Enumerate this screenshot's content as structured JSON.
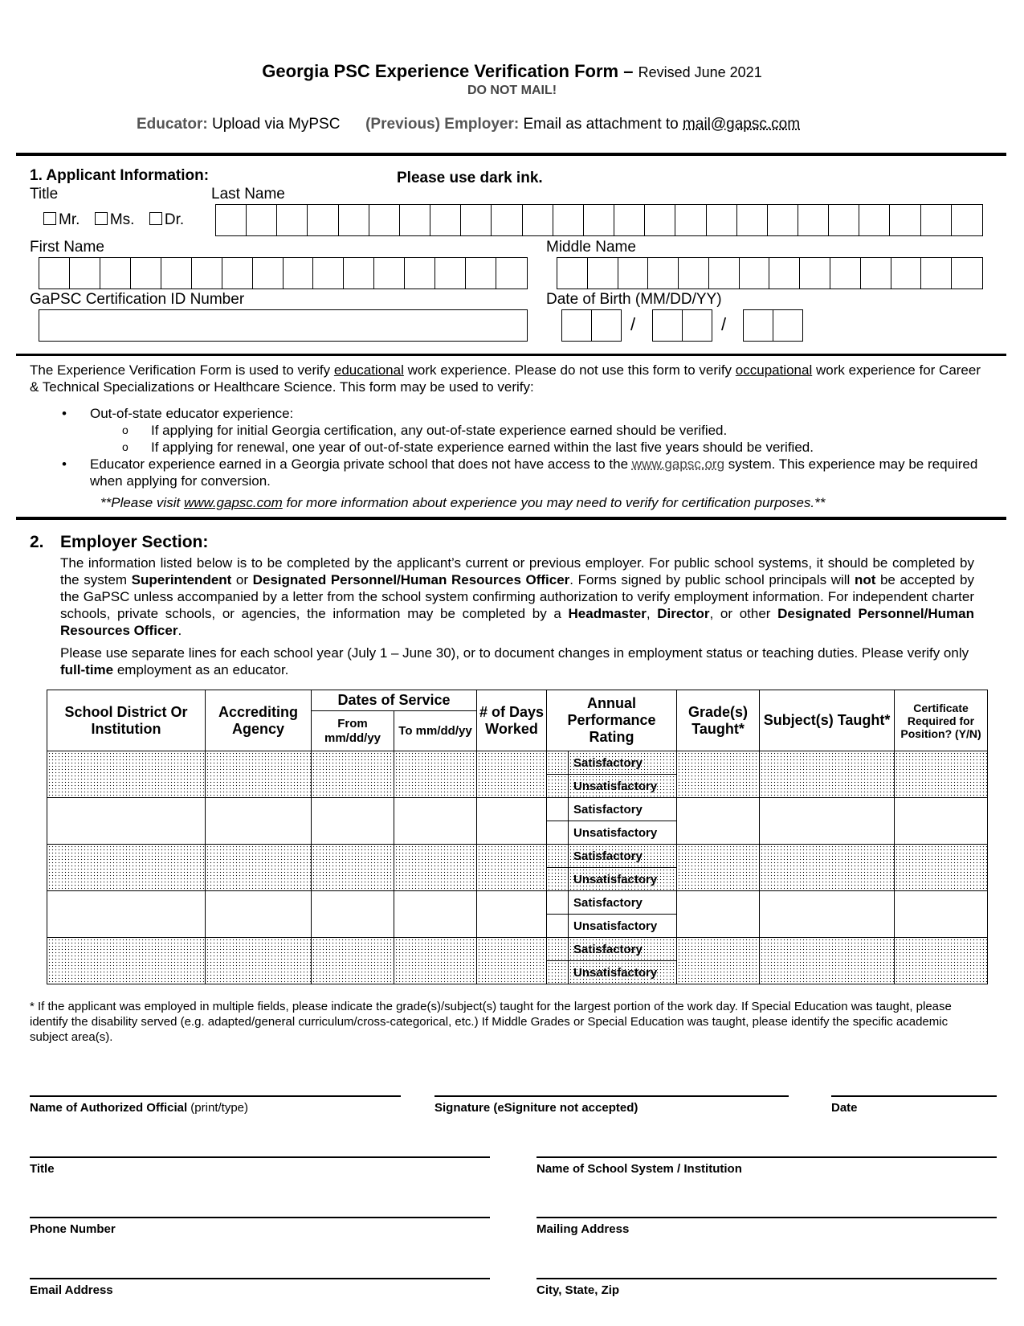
{
  "header": {
    "title": "Georgia PSC Experience Verification Form",
    "dash": " – ",
    "revised": "Revised June 2021",
    "do_not_mail": "DO NOT MAIL!",
    "educator_label": "Educator:",
    "educator_text": " Upload via MyPSC",
    "employer_label": "(Previous) Employer:",
    "employer_text": " Email as attachment to ",
    "email": "mail@gapsc.com"
  },
  "section1": {
    "heading": "1.   Applicant Information:",
    "ink_note": "Please use dark ink.",
    "title_label": "Title",
    "title_options": [
      "Mr.",
      "Ms.",
      "Dr."
    ],
    "last_name_label": "Last Name",
    "last_name_boxes": 25,
    "first_name_label": "First Name",
    "first_name_boxes": 16,
    "middle_name_label": "Middle Name",
    "middle_name_boxes": 14,
    "cert_id_label": "GaPSC Certification ID Number",
    "dob_label": "Date of Birth (MM/DD/YY)",
    "dob_separator": "/"
  },
  "info": {
    "line1_a": "The Experience Verification Form is used to verify ",
    "line1_u1": "educational",
    "line1_b": " work experience. Please do not use this form to verify ",
    "line1_u2": "occupational",
    "line1_c": " work experience for Career & Technical Specializations or Healthcare Science. This form may be used to verify:",
    "bullet1": "Out-of-state educator experience:",
    "sub1": "If applying for initial Georgia certification, any out-of-state experience earned should be verified.",
    "sub2": "If applying for renewal, one year of out-of-state experience earned within the last five years should be verified.",
    "bullet2_a": "Educator experience earned in a Georgia private school that does not have access to the ",
    "bullet2_link": "www.gapsc.org",
    "bullet2_b": " system. This experience may be required when applying for conversion.",
    "note_a": "**Please visit ",
    "note_link": "www.gapsc.com",
    "note_b": " for more information about experience you may need to verify for certification purposes.**"
  },
  "section2": {
    "heading_num": "2.",
    "heading": "Employer Section:",
    "p1_a": "The information listed below is to be completed by the applicant’s current or previous employer. For public school systems, it should be completed by the system ",
    "p1_b1": "Superintendent",
    "p1_c": " or ",
    "p1_b2": "Designated Personnel/Human Resources Officer",
    "p1_d": ". Forms signed by public school principals will ",
    "p1_b3": "not",
    "p1_e": " be accepted by the GaPSC unless accompanied by a letter from the school system confirming authorization to verify employment information.  For independent charter schools, private schools, or agencies, the information may be completed by a ",
    "p1_b4": "Headmaster",
    "p1_f": ", ",
    "p1_b5": "Director",
    "p1_g": ", or other ",
    "p1_b6": "Designated Personnel/Human Resources Officer",
    "p1_h": ".",
    "p2_a": "Please use separate lines for each school year (July 1 – June 30), or to document changes in employment status or teaching duties. Please verify only ",
    "p2_b": "full-time",
    "p2_c": " employment as an educator."
  },
  "table": {
    "headers": {
      "district": "School District Or Institution",
      "agency": "Accrediting Agency",
      "dates": "Dates of Service",
      "from": "From mm/dd/yy",
      "to": "To mm/dd/yy",
      "days": "# of Days Worked",
      "rating": "Annual Performance Rating",
      "grades": "Grade(s) Taught*",
      "subjects": "Subject(s) Taught*",
      "cert": "Certificate Required for Position? (Y/N)"
    },
    "rating_options": [
      "Satisfactory",
      "Unsatisfactory"
    ],
    "rows": 5
  },
  "footnote": "* If the applicant was employed in multiple fields, please indicate the grade(s)/subject(s) taught for the largest portion of the work day. If Special Education was taught, please identify the disability served (e.g. adapted/general curriculum/cross-categorical, etc.) If Middle Grades or Special Education was taught, please identify the specific academic subject area(s).",
  "signature": {
    "official_bold": "Name of Authorized Official",
    "official_normal": " (print/type)",
    "signature": "Signature (eSigniture not accepted)",
    "date": "Date",
    "title": "Title",
    "institution": "Name of School System / Institution",
    "phone": "Phone Number",
    "mailing": "Mailing Address",
    "email": "Email Address",
    "city": "City, State, Zip"
  }
}
